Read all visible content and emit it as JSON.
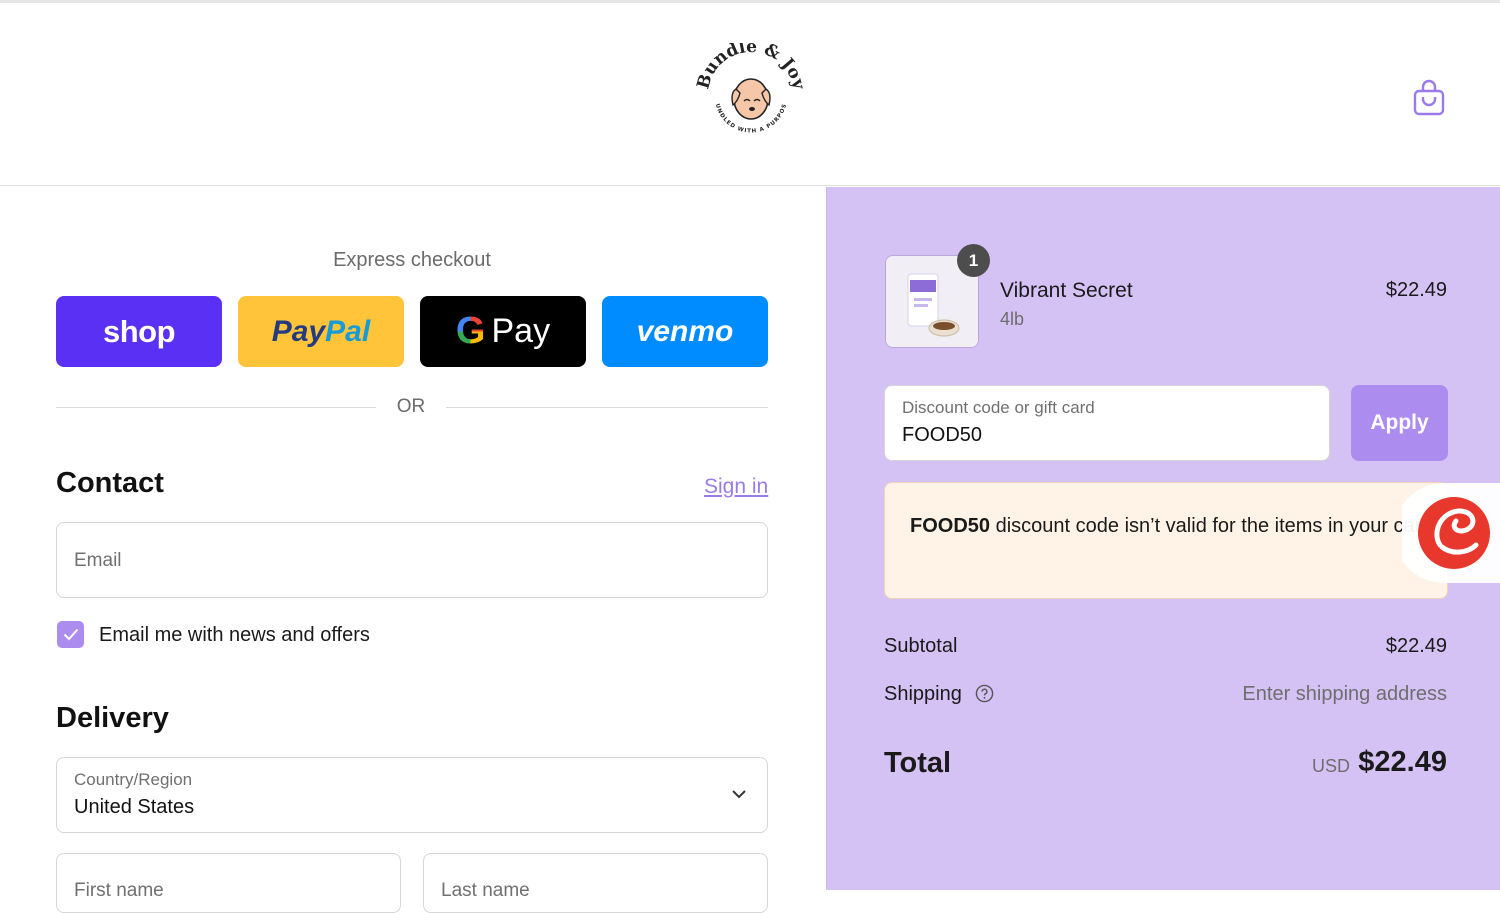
{
  "header": {
    "logo_text": "Bundle & Joy",
    "logo_tagline": "BUNDLED WITH A PURPOSE",
    "cart_icon": "shopping-bag-icon"
  },
  "express": {
    "label": "Express checkout",
    "buttons": [
      "shop",
      "PayPal",
      "G Pay",
      "venmo"
    ],
    "or_text": "OR"
  },
  "contact": {
    "heading": "Contact",
    "sign_in": "Sign in",
    "email_placeholder": "Email",
    "newsletter_label": "Email me with news and offers",
    "newsletter_checked": true
  },
  "delivery": {
    "heading": "Delivery",
    "country_label": "Country/Region",
    "country_value": "United States",
    "first_name_placeholder": "First name",
    "last_name_placeholder": "Last name"
  },
  "order": {
    "item": {
      "name": "Vibrant Secret",
      "variant": "4lb",
      "price": "$22.49",
      "quantity": "1"
    },
    "discount": {
      "label": "Discount code or gift card",
      "value": "FOOD50",
      "apply_label": "Apply"
    },
    "error": {
      "code": "FOOD50",
      "message": " discount code isn’t valid for the items in your cart"
    },
    "summary": {
      "subtotal_label": "Subtotal",
      "subtotal_value": "$22.49",
      "shipping_label": "Shipping",
      "shipping_value": "Enter shipping address",
      "total_label": "Total",
      "currency": "USD",
      "total_value": "$22.49"
    }
  },
  "colors": {
    "accent": "#ad8cf0",
    "sidebar_bg": "#d4c2f5",
    "error_bg": "#fff3e8",
    "shop_pay": "#5a31f4",
    "paypal": "#ffc439",
    "venmo": "#008cff"
  }
}
